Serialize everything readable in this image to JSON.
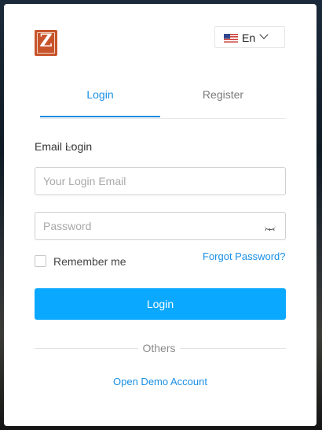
{
  "brand": {
    "logo_letter": "Z",
    "color": "#c8542b"
  },
  "language": {
    "flag_icon": "us-flag-icon",
    "code": "En"
  },
  "tabs": [
    {
      "label": "Login",
      "active": true
    },
    {
      "label": "Register",
      "active": false
    }
  ],
  "login_method": {
    "label": "Email Login"
  },
  "form": {
    "email_placeholder": "Your Login Email",
    "password_placeholder": "Password",
    "remember_label": "Remember me",
    "remember_checked": false,
    "forgot_label": "Forgot Password?",
    "submit_label": "Login"
  },
  "divider": {
    "label": "Others"
  },
  "demo_link": {
    "label": "Open Demo Account"
  },
  "colors": {
    "accent": "#0aa8ff",
    "link": "#1a8fe3"
  }
}
